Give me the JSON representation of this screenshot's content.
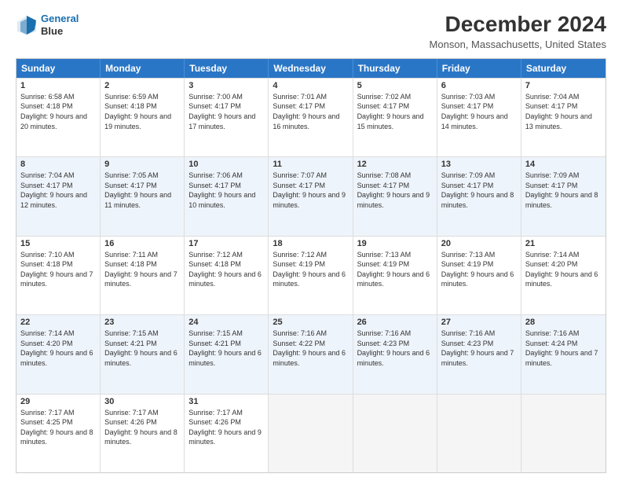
{
  "logo": {
    "line1": "General",
    "line2": "Blue"
  },
  "title": "December 2024",
  "subtitle": "Monson, Massachusetts, United States",
  "headers": [
    "Sunday",
    "Monday",
    "Tuesday",
    "Wednesday",
    "Thursday",
    "Friday",
    "Saturday"
  ],
  "weeks": [
    [
      {
        "day": "1",
        "sunrise": "6:58 AM",
        "sunset": "4:18 PM",
        "daylight": "9 hours and 20 minutes."
      },
      {
        "day": "2",
        "sunrise": "6:59 AM",
        "sunset": "4:18 PM",
        "daylight": "9 hours and 19 minutes."
      },
      {
        "day": "3",
        "sunrise": "7:00 AM",
        "sunset": "4:17 PM",
        "daylight": "9 hours and 17 minutes."
      },
      {
        "day": "4",
        "sunrise": "7:01 AM",
        "sunset": "4:17 PM",
        "daylight": "9 hours and 16 minutes."
      },
      {
        "day": "5",
        "sunrise": "7:02 AM",
        "sunset": "4:17 PM",
        "daylight": "9 hours and 15 minutes."
      },
      {
        "day": "6",
        "sunrise": "7:03 AM",
        "sunset": "4:17 PM",
        "daylight": "9 hours and 14 minutes."
      },
      {
        "day": "7",
        "sunrise": "7:04 AM",
        "sunset": "4:17 PM",
        "daylight": "9 hours and 13 minutes."
      }
    ],
    [
      {
        "day": "8",
        "sunrise": "7:04 AM",
        "sunset": "4:17 PM",
        "daylight": "9 hours and 12 minutes."
      },
      {
        "day": "9",
        "sunrise": "7:05 AM",
        "sunset": "4:17 PM",
        "daylight": "9 hours and 11 minutes."
      },
      {
        "day": "10",
        "sunrise": "7:06 AM",
        "sunset": "4:17 PM",
        "daylight": "9 hours and 10 minutes."
      },
      {
        "day": "11",
        "sunrise": "7:07 AM",
        "sunset": "4:17 PM",
        "daylight": "9 hours and 9 minutes."
      },
      {
        "day": "12",
        "sunrise": "7:08 AM",
        "sunset": "4:17 PM",
        "daylight": "9 hours and 9 minutes."
      },
      {
        "day": "13",
        "sunrise": "7:09 AM",
        "sunset": "4:17 PM",
        "daylight": "9 hours and 8 minutes."
      },
      {
        "day": "14",
        "sunrise": "7:09 AM",
        "sunset": "4:17 PM",
        "daylight": "9 hours and 8 minutes."
      }
    ],
    [
      {
        "day": "15",
        "sunrise": "7:10 AM",
        "sunset": "4:18 PM",
        "daylight": "9 hours and 7 minutes."
      },
      {
        "day": "16",
        "sunrise": "7:11 AM",
        "sunset": "4:18 PM",
        "daylight": "9 hours and 7 minutes."
      },
      {
        "day": "17",
        "sunrise": "7:12 AM",
        "sunset": "4:18 PM",
        "daylight": "9 hours and 6 minutes."
      },
      {
        "day": "18",
        "sunrise": "7:12 AM",
        "sunset": "4:19 PM",
        "daylight": "9 hours and 6 minutes."
      },
      {
        "day": "19",
        "sunrise": "7:13 AM",
        "sunset": "4:19 PM",
        "daylight": "9 hours and 6 minutes."
      },
      {
        "day": "20",
        "sunrise": "7:13 AM",
        "sunset": "4:19 PM",
        "daylight": "9 hours and 6 minutes."
      },
      {
        "day": "21",
        "sunrise": "7:14 AM",
        "sunset": "4:20 PM",
        "daylight": "9 hours and 6 minutes."
      }
    ],
    [
      {
        "day": "22",
        "sunrise": "7:14 AM",
        "sunset": "4:20 PM",
        "daylight": "9 hours and 6 minutes."
      },
      {
        "day": "23",
        "sunrise": "7:15 AM",
        "sunset": "4:21 PM",
        "daylight": "9 hours and 6 minutes."
      },
      {
        "day": "24",
        "sunrise": "7:15 AM",
        "sunset": "4:21 PM",
        "daylight": "9 hours and 6 minutes."
      },
      {
        "day": "25",
        "sunrise": "7:16 AM",
        "sunset": "4:22 PM",
        "daylight": "9 hours and 6 minutes."
      },
      {
        "day": "26",
        "sunrise": "7:16 AM",
        "sunset": "4:23 PM",
        "daylight": "9 hours and 6 minutes."
      },
      {
        "day": "27",
        "sunrise": "7:16 AM",
        "sunset": "4:23 PM",
        "daylight": "9 hours and 7 minutes."
      },
      {
        "day": "28",
        "sunrise": "7:16 AM",
        "sunset": "4:24 PM",
        "daylight": "9 hours and 7 minutes."
      }
    ],
    [
      {
        "day": "29",
        "sunrise": "7:17 AM",
        "sunset": "4:25 PM",
        "daylight": "9 hours and 8 minutes."
      },
      {
        "day": "30",
        "sunrise": "7:17 AM",
        "sunset": "4:26 PM",
        "daylight": "9 hours and 8 minutes."
      },
      {
        "day": "31",
        "sunrise": "7:17 AM",
        "sunset": "4:26 PM",
        "daylight": "9 hours and 9 minutes."
      },
      null,
      null,
      null,
      null
    ]
  ]
}
